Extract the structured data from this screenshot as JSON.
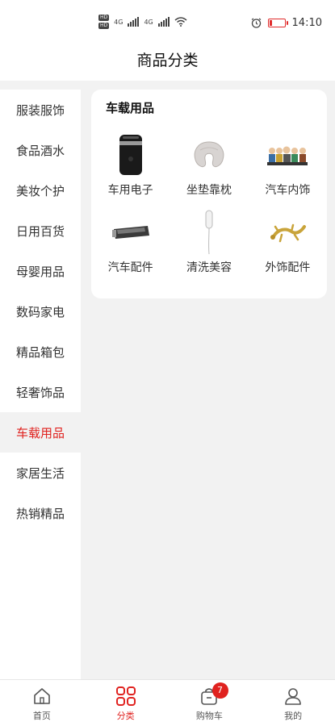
{
  "status_bar": {
    "time": "14:10",
    "hd_labels": [
      "HD",
      "HD"
    ],
    "net_labels": [
      "4G",
      "4G"
    ]
  },
  "header": {
    "title": "商品分类"
  },
  "sidebar": {
    "items": [
      {
        "label": "服装服饰"
      },
      {
        "label": "食品酒水"
      },
      {
        "label": "美妆个护"
      },
      {
        "label": "日用百货"
      },
      {
        "label": "母婴用品"
      },
      {
        "label": "数码家电"
      },
      {
        "label": "精品箱包"
      },
      {
        "label": "轻奢饰品"
      },
      {
        "label": "车载用品"
      },
      {
        "label": "家居生活"
      },
      {
        "label": "热销精品"
      }
    ],
    "active_index": 8
  },
  "content": {
    "section_title": "车载用品",
    "items": [
      {
        "label": "车用电子",
        "icon": "car-electronics-icon"
      },
      {
        "label": "坐垫靠枕",
        "icon": "neck-pillow-icon"
      },
      {
        "label": "汽车内饰",
        "icon": "car-figurines-icon"
      },
      {
        "label": "汽车配件",
        "icon": "parking-number-plate-icon"
      },
      {
        "label": "清洗美容",
        "icon": "charging-cable-icon"
      },
      {
        "label": "外饰配件",
        "icon": "gecko-emblem-icon"
      }
    ]
  },
  "tabbar": {
    "tabs": [
      {
        "label": "首页",
        "icon": "home-icon"
      },
      {
        "label": "分类",
        "icon": "category-grid-icon"
      },
      {
        "label": "购物车",
        "icon": "cart-icon",
        "badge": "7"
      },
      {
        "label": "我的",
        "icon": "user-icon"
      }
    ],
    "active_index": 1
  },
  "colors": {
    "accent": "#e0221f",
    "background": "#f2f2f2"
  }
}
